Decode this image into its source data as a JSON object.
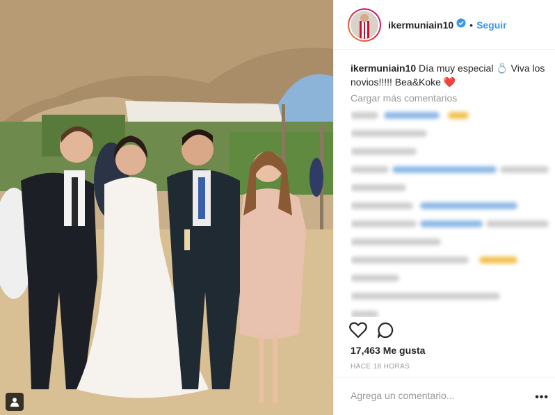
{
  "post": {
    "username": "ikermuniain10",
    "follow_label": "Seguir",
    "caption_text": "Día muy especial 💍 Viva los novios!!!!! Bea&Koke ❤️",
    "load_more_label": "Cargar más comentarios",
    "likes": "17,463 Me gusta",
    "timestamp": "HACE 18 HORAS",
    "comment_placeholder": "Agrega un comentario...",
    "more_label": "•••"
  },
  "icons": {
    "verified": "verified-badge-icon",
    "like": "heart-icon",
    "comment": "comment-bubble-icon",
    "tag": "person-tag-icon",
    "more": "more-options-icon"
  },
  "colors": {
    "link_blue": "#3897f0",
    "heart_red": "#ed4956",
    "muted_gray": "#999999"
  }
}
